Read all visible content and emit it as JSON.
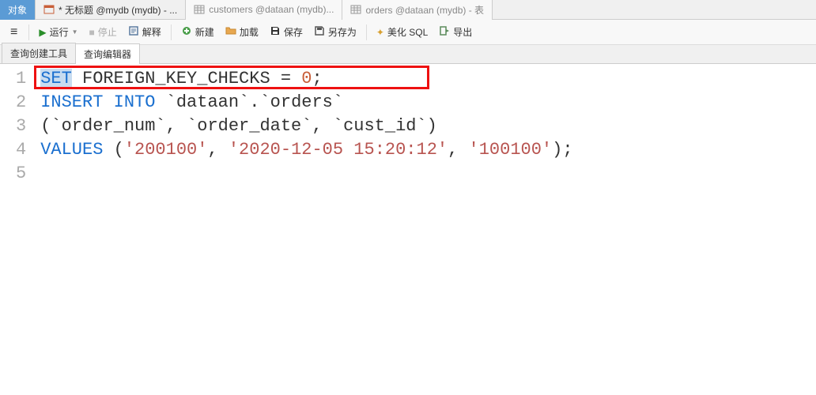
{
  "tabs": [
    {
      "label": "对象",
      "icon_name": "object-icon",
      "active": true
    },
    {
      "label": "* 无标题 @mydb (mydb) - ...",
      "icon_name": "query-tab-icon",
      "active": false
    },
    {
      "label": "customers @dataan (mydb)...",
      "icon_name": "table-tab-icon",
      "active": false
    },
    {
      "label": "orders @dataan (mydb) - 表",
      "icon_name": "table-tab-icon",
      "active": false
    }
  ],
  "toolbar": {
    "run": "运行",
    "stop": "停止",
    "explain": "解释",
    "new": "新建",
    "load": "加载",
    "save": "保存",
    "saveas": "另存为",
    "beautify": "美化 SQL",
    "export": "导出"
  },
  "sub_tabs": {
    "builder": "查询创建工具",
    "editor": "查询编辑器"
  },
  "code": {
    "lines": [
      "1",
      "2",
      "3",
      "4",
      "5"
    ],
    "l1_set": "SET",
    "l1_fk": " FOREIGN_KEY_CHECKS = ",
    "l1_zero": "0",
    "l1_semi": ";",
    "l2_insert": "INSERT",
    "l2_into": " INTO",
    "l2_rest": " `dataan`.`orders`",
    "l3": "(`order_num`, `order_date`, `cust_id`)",
    "l4_values": "VALUES",
    "l4_open": " (",
    "l4_v1": "'200100'",
    "l4_c1": ", ",
    "l4_v2": "'2020-12-05 15:20:12'",
    "l4_c2": ", ",
    "l4_v3": "'100100'",
    "l4_close": ");"
  }
}
